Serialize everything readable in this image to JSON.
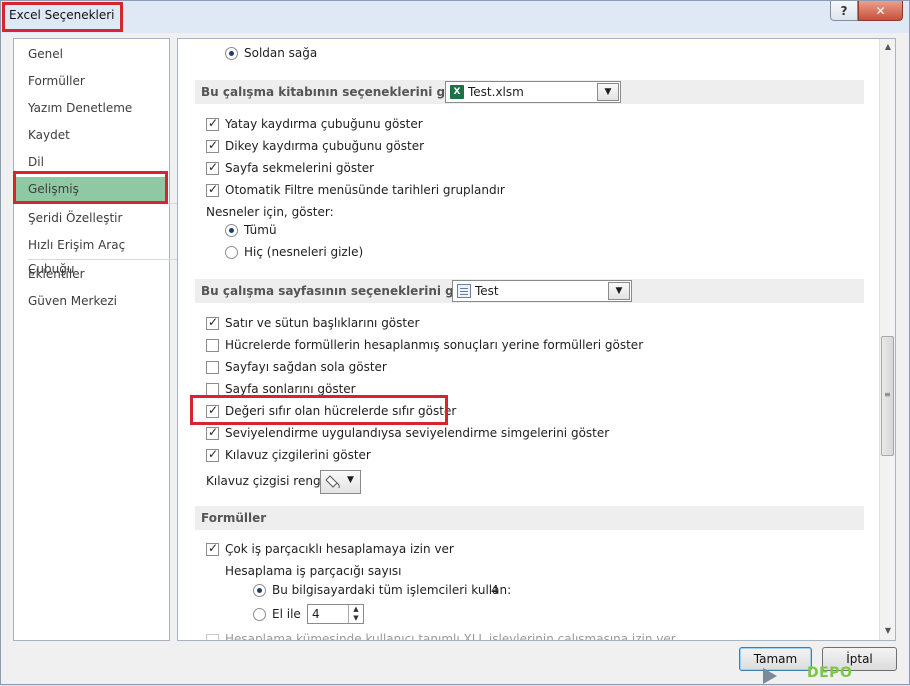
{
  "window": {
    "title": "Excel Seçenekleri",
    "help_label": "?",
    "close_label": "✕"
  },
  "nav": {
    "items": [
      {
        "label": "Genel"
      },
      {
        "label": "Formüller"
      },
      {
        "label": "Yazım Denetleme"
      },
      {
        "label": "Kaydet"
      },
      {
        "label": "Dil"
      },
      {
        "label": "Gelişmiş",
        "active": true
      },
      {
        "label": "Şeridi Özelleştir"
      },
      {
        "label": "Hızlı Erişim Araç Çubuğu"
      },
      {
        "label": "Eklentiler"
      },
      {
        "label": "Güven Merkezi"
      }
    ]
  },
  "content": {
    "direction_option": "Soldan sağa",
    "workbook_section": {
      "title": "Bu çalışma kitabının seçeneklerini göster:",
      "selected": "Test.xlsm"
    },
    "workbook_options": [
      {
        "label": "Yatay kaydırma çubuğunu göster",
        "checked": true
      },
      {
        "label": "Dikey kaydırma çubuğunu göster",
        "checked": true
      },
      {
        "label": "Sayfa sekmelerini göster",
        "checked": true
      },
      {
        "label": "Otomatik Filtre menüsünde tarihleri gruplandır",
        "checked": true
      }
    ],
    "objects_label": "Nesneler için, göster:",
    "objects_options": [
      {
        "label": "Tümü",
        "selected": true
      },
      {
        "label": "Hiç (nesneleri gizle)",
        "selected": false
      }
    ],
    "sheet_section": {
      "title": "Bu çalışma sayfasının seçeneklerini göster:",
      "selected": "Test"
    },
    "sheet_options": [
      {
        "label": "Satır ve sütun başlıklarını göster",
        "checked": true
      },
      {
        "label": "Hücrelerde formüllerin hesaplanmış sonuçları yerine formülleri göster",
        "checked": false
      },
      {
        "label": "Sayfayı sağdan sola göster",
        "checked": false
      },
      {
        "label": "Sayfa sonlarını göster",
        "checked": false
      },
      {
        "label": "Değeri sıfır olan hücrelerde sıfır göster",
        "checked": true
      },
      {
        "label": "Seviyelendirme uygulandıysa seviyelendirme simgelerini göster",
        "checked": true
      },
      {
        "label": "Kılavuz çizgilerini göster",
        "checked": true
      }
    ],
    "gridline_color_label": "Kılavuz çizgisi rengi",
    "formulas_section": {
      "title": "Formüller"
    },
    "multithread_label": "Çok iş parçacıklı hesaplamaya izin ver",
    "threads_label": "Hesaplama iş parçacığı sayısı",
    "all_processors_label": "Bu bilgisayardaki tüm işlemcileri kullan:",
    "processor_count": "4",
    "manual_label": "El ile",
    "manual_value": "4",
    "xll_label": "Hesaplama kümesinde kullanıcı tanımlı XLL işlevlerinin çalışmasına izin ver"
  },
  "buttons": {
    "ok": "Tamam",
    "cancel": "İptal"
  },
  "watermark": {
    "text": "DEPO"
  },
  "colors": {
    "highlight": "#d6252f",
    "nav_active": "#8fc9a3",
    "excel_green": "#1e7145"
  }
}
